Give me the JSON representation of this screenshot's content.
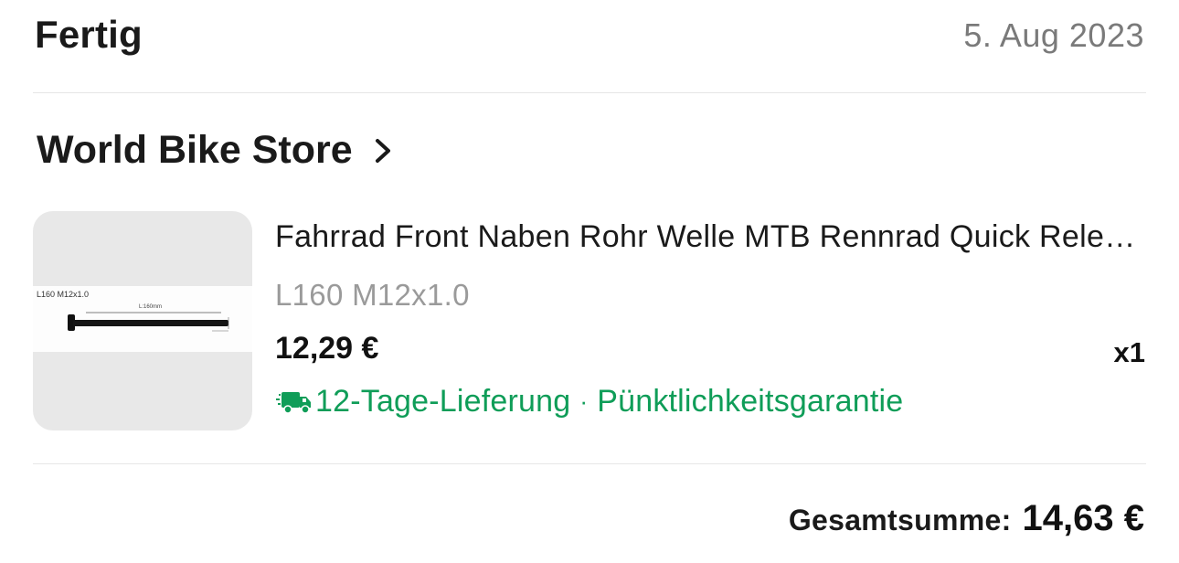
{
  "order": {
    "status": "Fertig",
    "date": "5. Aug 2023"
  },
  "store": {
    "name": "World Bike Store",
    "chevron_icon": "chevron-right-icon"
  },
  "item": {
    "image_label": "L160 M12x1.0",
    "image_dimension": "L:160mm",
    "title": "Fahrrad Front Naben Rohr Welle MTB Rennrad Quick Release Steckachse",
    "variant": "L160 M12x1.0",
    "price": "12,29 €",
    "quantity": "x1",
    "delivery": {
      "icon": "delivery-truck-icon",
      "time": "12-Tage-Lieferung",
      "separator": "·",
      "guarantee": "Pünktlichkeitsgarantie",
      "color": "#0f9d58"
    }
  },
  "summary": {
    "total_label": "Gesamtsumme:",
    "total_value": "14,63 €"
  }
}
